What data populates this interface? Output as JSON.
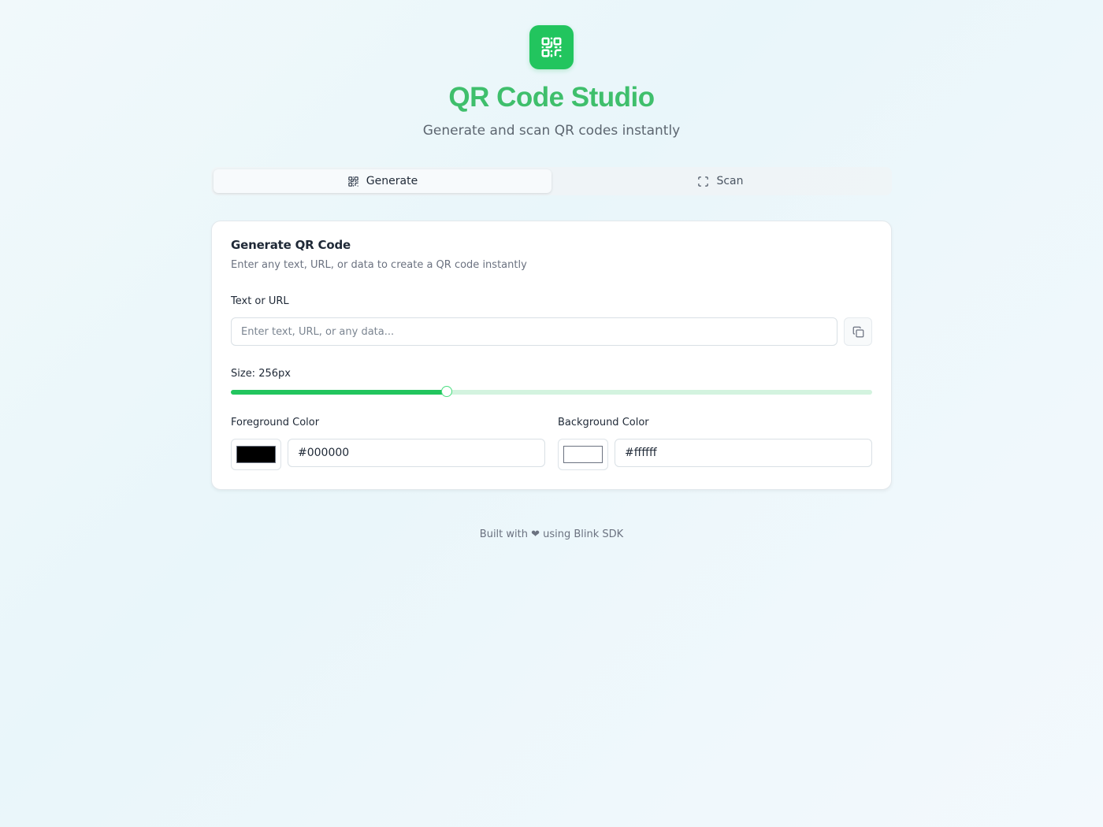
{
  "header": {
    "logo_icon": "qr-code-icon",
    "title": "QR Code Studio",
    "subtitle": "Generate and scan QR codes instantly"
  },
  "tabs": [
    {
      "label": "Generate",
      "icon": "qr-code-icon",
      "active": true
    },
    {
      "label": "Scan",
      "icon": "scan-frame-icon",
      "active": false
    }
  ],
  "card": {
    "title": "Generate QR Code",
    "description": "Enter any text, URL, or data to create a QR code instantly",
    "text_label": "Text or URL",
    "text_placeholder": "Enter text, URL, or any data...",
    "text_value": "",
    "copy_icon": "copy-icon",
    "size_label": "Size: 256px",
    "size_value": 256,
    "size_fraction": 0.3366,
    "foreground_label": "Foreground Color",
    "foreground_value": "#000000",
    "background_label": "Background Color",
    "background_value": "#ffffff"
  },
  "footer": {
    "text": "Built with ❤ using Blink SDK"
  },
  "colors": {
    "accent": "#22c55e",
    "title": "#3fbf6c",
    "slider_track": "#d3f3df"
  }
}
